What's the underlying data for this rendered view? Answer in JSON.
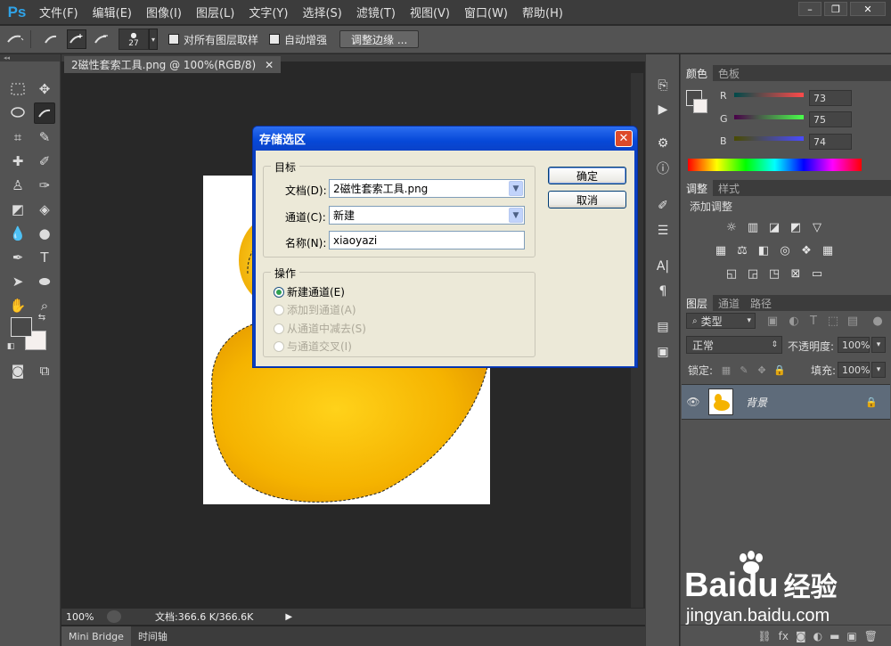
{
  "app": {
    "logo": "Ps",
    "menu": [
      "文件(F)",
      "编辑(E)",
      "图像(I)",
      "图层(L)",
      "文字(Y)",
      "选择(S)",
      "滤镜(T)",
      "视图(V)",
      "窗口(W)",
      "帮助(H)"
    ]
  },
  "options_bar": {
    "brush_size": "27",
    "sample_all_layers": "对所有图层取样",
    "auto_enhance": "自动增强",
    "refine_edge": "调整边缘 ..."
  },
  "document": {
    "tab_title": "2磁性套索工具.png @ 100%(RGB/8)",
    "zoom": "100%",
    "doc_info": "文档:366.6 K/366.6K"
  },
  "bottom_tabs": [
    "Mini Bridge",
    "时间轴"
  ],
  "dialog": {
    "title": "存储选区",
    "target_group": "目标",
    "doc_label": "文档(D):",
    "doc_value": "2磁性套索工具.png",
    "channel_label": "通道(C):",
    "channel_value": "新建",
    "name_label": "名称(N):",
    "name_value": "xiaoyazi",
    "operation_group": "操作",
    "ops": [
      "新建通道(E)",
      "添加到通道(A)",
      "从通道中减去(S)",
      "与通道交叉(I)"
    ],
    "ok": "确定",
    "cancel": "取消"
  },
  "color_panel": {
    "tabs": [
      "颜色",
      "色板"
    ],
    "r_label": "R",
    "r_value": "73",
    "g_label": "G",
    "g_value": "75",
    "b_label": "B",
    "b_value": "74"
  },
  "adjust_panel": {
    "tabs": [
      "调整",
      "样式"
    ],
    "heading": "添加调整"
  },
  "layers_panel": {
    "tabs": [
      "图层",
      "通道",
      "路径"
    ],
    "filter_kind": "类型",
    "blend_mode": "正常",
    "opacity_label": "不透明度:",
    "opacity_value": "100%",
    "lock_label": "锁定:",
    "fill_label": "填充:",
    "fill_value": "100%",
    "layer_name": "背景"
  },
  "watermark": {
    "brand": "Bai",
    "brand_rest": "du",
    "product": "经验",
    "url": "jingyan.baidu.com"
  },
  "colors": {
    "dialog_title": "#0648d8",
    "ps_blue": "#2fa3e8",
    "duck_yellow": "#f5b800"
  }
}
